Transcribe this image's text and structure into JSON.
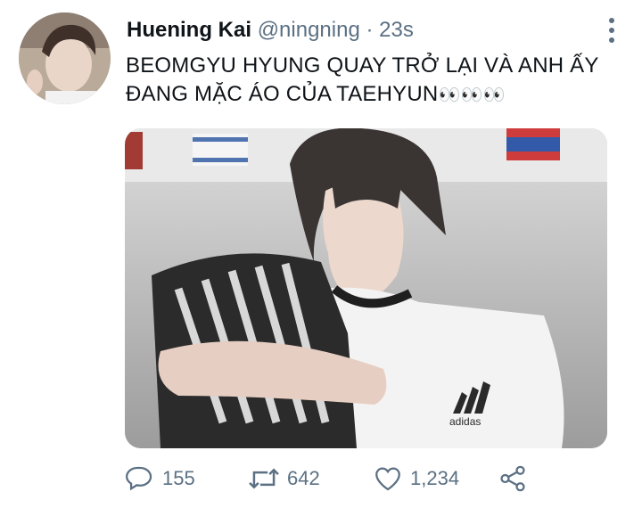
{
  "tweet": {
    "author_name": "Huening Kai",
    "author_handle": "@ningning",
    "separator": "·",
    "time": "23s",
    "text": "BEOMGYU HYUNG QUAY TRỞ LẠI VÀ ANH ẤY ĐANG MẶC ÁO CỦA TAEHYUN",
    "emoji": "👀👀👀"
  },
  "media": {
    "shirt_brand": "adidas"
  },
  "actions": {
    "replies": "155",
    "retweets": "642",
    "likes": "1,234"
  },
  "icons": {
    "reply": "reply-icon",
    "retweet": "retweet-icon",
    "like": "like-icon",
    "share": "share-icon",
    "more": "more-options-icon"
  },
  "colors": {
    "text": "#0f1419",
    "secondary": "#5b7083"
  }
}
